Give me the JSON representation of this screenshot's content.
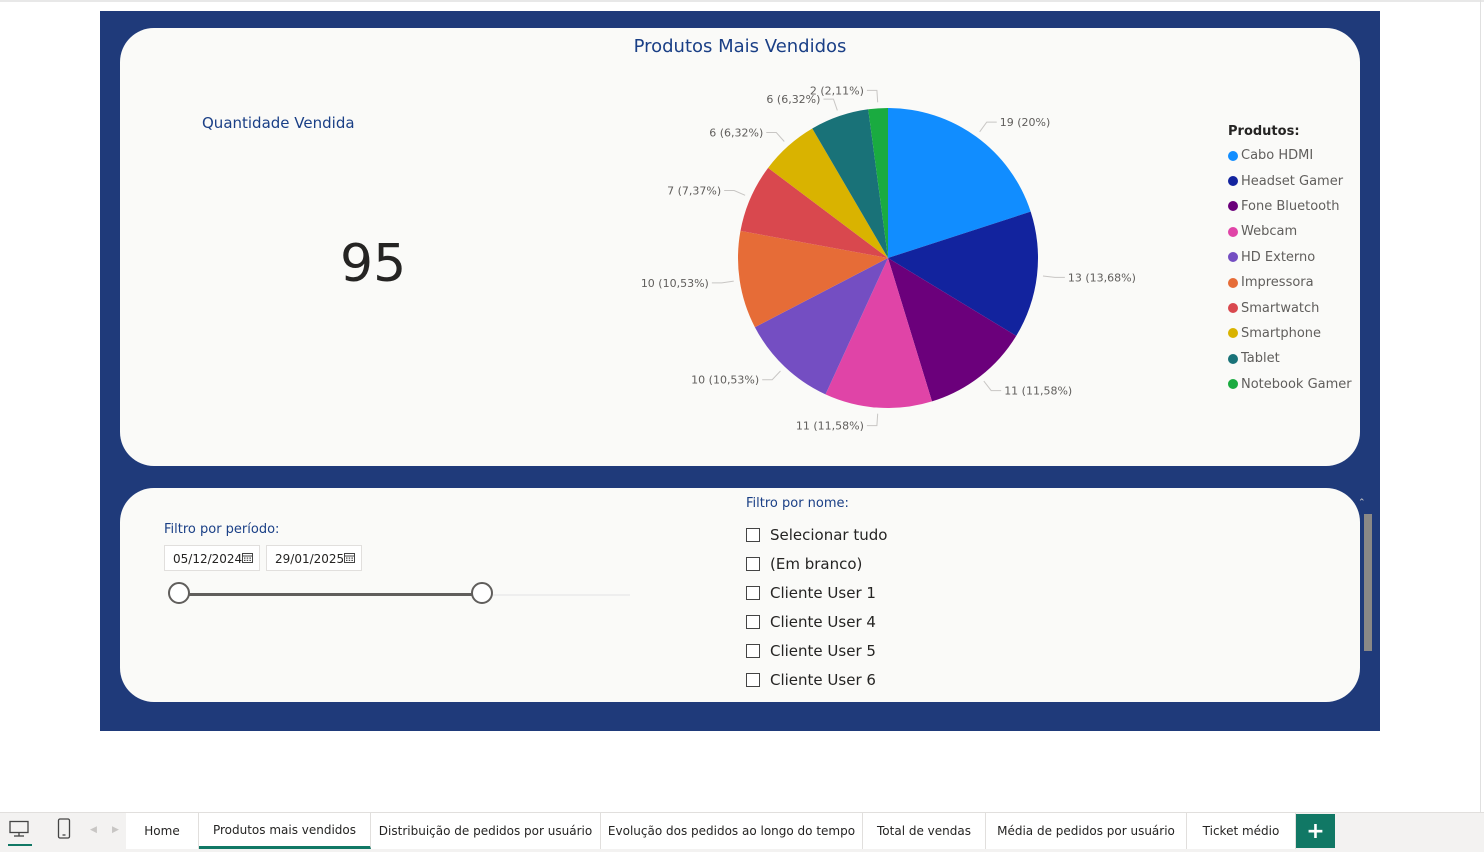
{
  "report": {
    "chart_title": "Produtos Mais Vendidos",
    "kpi_label": "Quantidade Vendida",
    "kpi_value": "95",
    "legend_title": "Produtos:"
  },
  "chart_data": {
    "type": "pie",
    "title": "Produtos Mais Vendidos",
    "legend_title": "Produtos:",
    "legend_position": "right",
    "slices": [
      {
        "name": "Cabo HDMI",
        "value": 19,
        "label": "19 (20%)",
        "color": "#118dff"
      },
      {
        "name": "Headset Gamer",
        "value": 13,
        "label": "13 (13,68%)",
        "color": "#12239e"
      },
      {
        "name": "Fone Bluetooth",
        "value": 11,
        "label": "11 (11,58%)",
        "color": "#6b007b"
      },
      {
        "name": "Webcam",
        "value": 11,
        "label": "11 (11,58%)",
        "color": "#e044a7"
      },
      {
        "name": "HD Externo",
        "value": 10,
        "label": "10 (10,53%)",
        "color": "#744ec2"
      },
      {
        "name": "Impressora",
        "value": 10,
        "label": "10 (10,53%)",
        "color": "#e66c37"
      },
      {
        "name": "Smartwatch",
        "value": 7,
        "label": "7 (7,37%)",
        "color": "#d9484e"
      },
      {
        "name": "Smartphone",
        "value": 6,
        "label": "6 (6,32%)",
        "color": "#d9b300"
      },
      {
        "name": "Tablet",
        "value": 6,
        "label": "6 (6,32%)",
        "color": "#197278"
      },
      {
        "name": "Notebook Gamer",
        "value": 2,
        "label": "2 (2,11%)",
        "color": "#1aab40"
      }
    ]
  },
  "filters": {
    "period_title": "Filtro por período:",
    "start_date": "05/12/2024",
    "end_date": "29/01/2025",
    "range_fraction": 0.67,
    "name_title": "Filtro por nome:",
    "name_options": [
      "Selecionar tudo",
      "(Em branco)",
      "Cliente User 1",
      "Cliente User 4",
      "Cliente User 5",
      "Cliente User 6"
    ]
  },
  "tabs": [
    "Home",
    "Produtos mais vendidos",
    "Distribuição de pedidos por usuário",
    "Evolução dos pedidos ao longo do tempo",
    "Total de vendas",
    "Média de pedidos por usuário",
    "Ticket médio"
  ],
  "active_tab": "Produtos mais vendidos",
  "add_page_label": "+",
  "icons": {
    "desktop": "desktop-layout-icon",
    "mobile": "mobile-layout-icon",
    "calendar": "calendar-icon"
  },
  "colors": {
    "canvas": "#1f3a7a",
    "title": "#1a3f86",
    "accent": "#117865"
  }
}
